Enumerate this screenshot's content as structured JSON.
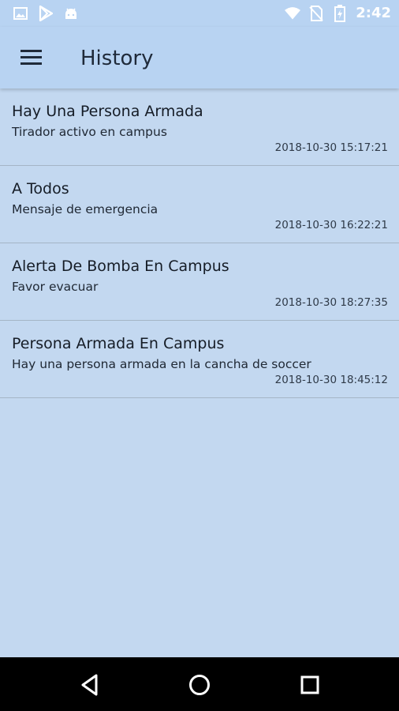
{
  "status_bar": {
    "left_icons": [
      "image-icon",
      "play-store-icon",
      "android-icon"
    ],
    "right_icons": [
      "wifi-icon",
      "no-sim-icon",
      "battery-charging-icon"
    ],
    "time": "2:42"
  },
  "app_bar": {
    "title": "History",
    "menu_icon": "hamburger-menu-icon"
  },
  "history": [
    {
      "title": "Hay Una Persona Armada",
      "message": "Tirador activo en campus",
      "timestamp": "2018-10-30 15:17:21"
    },
    {
      "title": "A Todos",
      "message": "Mensaje de emergencia",
      "timestamp": "2018-10-30 16:22:21"
    },
    {
      "title": "Alerta De Bomba En Campus",
      "message": "Favor evacuar",
      "timestamp": "2018-10-30 18:27:35"
    },
    {
      "title": "Persona Armada En Campus",
      "message": "Hay una persona armada en la cancha de soccer",
      "timestamp": "2018-10-30 18:45:12"
    }
  ],
  "nav_bar": {
    "buttons": [
      "back-icon",
      "home-icon",
      "recents-icon"
    ]
  },
  "colors": {
    "app_bar": "#b8d3f2",
    "background": "#c3d8f0",
    "divider": "#a5b5c6",
    "nav_bar": "#000000"
  }
}
